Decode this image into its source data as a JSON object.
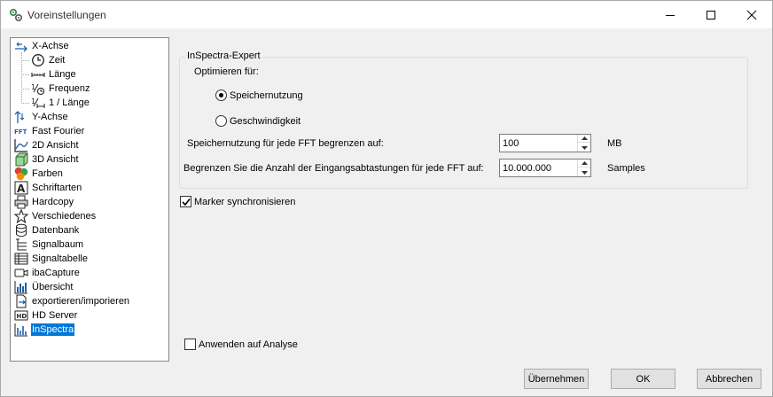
{
  "window": {
    "title": "Voreinstellungen"
  },
  "tree": {
    "items": [
      {
        "label": "X-Achse",
        "icon": "x-axis-icon"
      },
      {
        "label": "Zeit",
        "icon": "clock-icon"
      },
      {
        "label": "Länge",
        "icon": "length-icon"
      },
      {
        "label": "Frequenz",
        "icon": "frequency-icon"
      },
      {
        "label": "1 / Länge",
        "icon": "inverse-length-icon"
      },
      {
        "label": "Y-Achse",
        "icon": "y-axis-icon"
      },
      {
        "label": "Fast Fourier",
        "icon": "fft-icon",
        "icon_text": "FFT"
      },
      {
        "label": "2D Ansicht",
        "icon": "2d-chart-icon"
      },
      {
        "label": "3D Ansicht",
        "icon": "3d-cube-icon"
      },
      {
        "label": "Farben",
        "icon": "colors-icon"
      },
      {
        "label": "Schriftarten",
        "icon": "font-icon"
      },
      {
        "label": "Hardcopy",
        "icon": "printer-icon"
      },
      {
        "label": "Verschiedenes",
        "icon": "star-icon"
      },
      {
        "label": "Datenbank",
        "icon": "database-icon"
      },
      {
        "label": "Signalbaum",
        "icon": "signal-tree-icon"
      },
      {
        "label": "Signaltabelle",
        "icon": "table-icon"
      },
      {
        "label": "ibaCapture",
        "icon": "camera-icon"
      },
      {
        "label": "Übersicht",
        "icon": "overview-chart-icon"
      },
      {
        "label": "exportieren/imporieren",
        "icon": "export-import-icon"
      },
      {
        "label": "HD Server",
        "icon": "hd-server-icon",
        "icon_text": "HD"
      },
      {
        "label": "InSpectra",
        "icon": "inspectra-icon",
        "selected": true
      }
    ]
  },
  "inspectra": {
    "group_title": "InSpectra-Expert",
    "optimize_label": "Optimieren für:",
    "radio_memory": "Speichernutzung",
    "radio_speed": "Geschwindigkeit",
    "selected_option": "Speichernutzung",
    "memory_limit_label": "Speichernutzung für jede FFT begrenzen auf:",
    "memory_limit_value": "100",
    "memory_limit_unit": "MB",
    "samples_limit_label": "Begrenzen Sie die Anzahl der Eingangsabtastungen für jede FFT auf:",
    "samples_limit_value": "10.000.000",
    "samples_limit_unit": "Samples"
  },
  "marker_sync": {
    "label": "Marker synchronisieren",
    "checked": true
  },
  "apply_analysis": {
    "label": "Anwenden auf Analyse",
    "checked": false
  },
  "buttons": {
    "apply": "Übernehmen",
    "ok": "OK",
    "cancel": "Abbrechen"
  },
  "colors": {
    "selection": "#0078d7",
    "icon_blue": "#1f5fa8"
  }
}
